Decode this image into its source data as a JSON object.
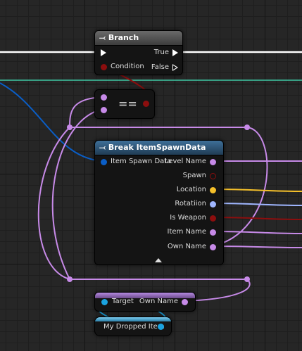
{
  "branch": {
    "title": "Branch",
    "icon": "branch-icon",
    "true_label": "True",
    "condition_label": "Condition",
    "false_label": "False"
  },
  "equal": {
    "label": "=="
  },
  "break": {
    "title": "Break ItemSpawnData",
    "icon": "break-struct-icon",
    "input_label": "Item Spawn Data",
    "outputs": [
      "Level Name",
      "Spawn",
      "Location",
      "Rotatiion",
      "Is Weapon",
      "Item Name",
      "Own Name"
    ]
  },
  "getter": {
    "target_label": "Target",
    "output_label": "Own Name"
  },
  "variable": {
    "label": "My Dropped Item"
  },
  "colors": {
    "exec": "#ffffff",
    "bool": "#8c0e0e",
    "name": "#c78ae8",
    "struct": "#0a5ec7",
    "vector": "#f5c02a",
    "rotator": "#9fb6ff",
    "object": "#1aa3e0",
    "wire_teal": "#3fc7a3"
  }
}
